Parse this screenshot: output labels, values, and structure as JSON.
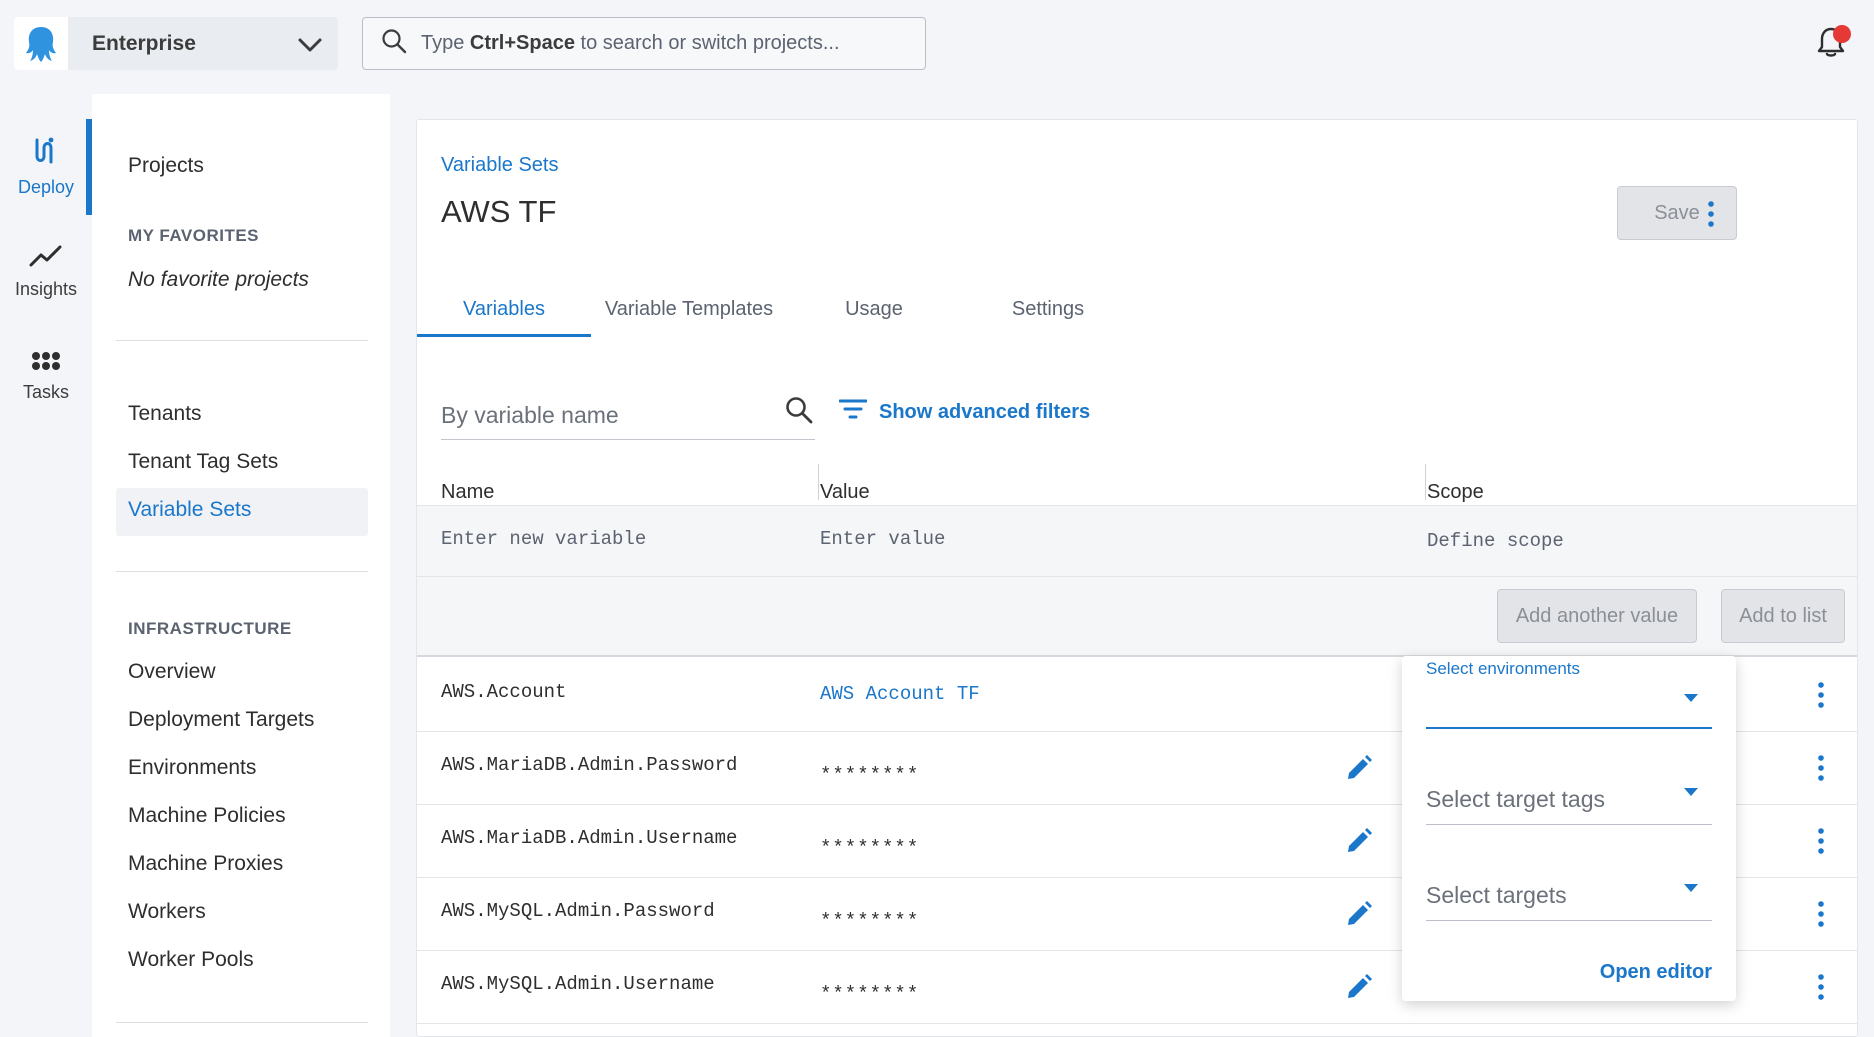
{
  "header": {
    "space_name": "Enterprise",
    "search": {
      "prefix": "Type ",
      "shortcut": "Ctrl+Space",
      "suffix": " to search or switch projects..."
    }
  },
  "rail": {
    "items": [
      {
        "label": "Deploy",
        "icon": "deploy-icon",
        "active": true
      },
      {
        "label": "Insights",
        "icon": "trend-icon",
        "active": false
      },
      {
        "label": "Tasks",
        "icon": "grid-dots-icon",
        "active": false
      }
    ]
  },
  "sidebar": {
    "projects": "Projects",
    "favorites_heading": "MY FAVORITES",
    "no_favorites": "No favorite projects",
    "library": [
      "Tenants",
      "Tenant Tag Sets",
      "Variable Sets"
    ],
    "active_item": "Variable Sets",
    "infra_heading": "INFRASTRUCTURE",
    "infrastructure": [
      "Overview",
      "Deployment Targets",
      "Environments",
      "Machine Policies",
      "Machine Proxies",
      "Workers",
      "Worker Pools"
    ]
  },
  "main": {
    "breadcrumb": "Variable Sets",
    "title": "AWS TF",
    "save_label": "Save",
    "tabs": [
      "Variables",
      "Variable Templates",
      "Usage",
      "Settings"
    ],
    "active_tab": "Variables",
    "filter_placeholder": "By variable name",
    "advanced_filters": "Show advanced filters",
    "columns": [
      "Name",
      "Value",
      "Scope"
    ],
    "new_variable": {
      "name_placeholder": "Enter new variable",
      "value_placeholder": "Enter value",
      "scope_placeholder": "Define scope"
    },
    "add_another_value": "Add another value",
    "add_to_list": "Add to list",
    "variables": [
      {
        "name": "AWS.Account",
        "value": "AWS Account TF",
        "sensitive": false
      },
      {
        "name": "AWS.MariaDB.Admin.Password",
        "value": "********",
        "sensitive": true
      },
      {
        "name": "AWS.MariaDB.Admin.Username",
        "value": "********",
        "sensitive": true
      },
      {
        "name": "AWS.MySQL.Admin.Password",
        "value": "********",
        "sensitive": true
      },
      {
        "name": "AWS.MySQL.Admin.Username",
        "value": "********",
        "sensitive": true
      }
    ]
  },
  "scope_popover": {
    "environments_label": "Select environments",
    "target_tags_placeholder": "Select target tags",
    "targets_placeholder": "Select targets",
    "open_editor": "Open editor"
  },
  "colors": {
    "accent": "#1a77ca",
    "notification": "#e53935",
    "text": "#2e2e2e"
  }
}
